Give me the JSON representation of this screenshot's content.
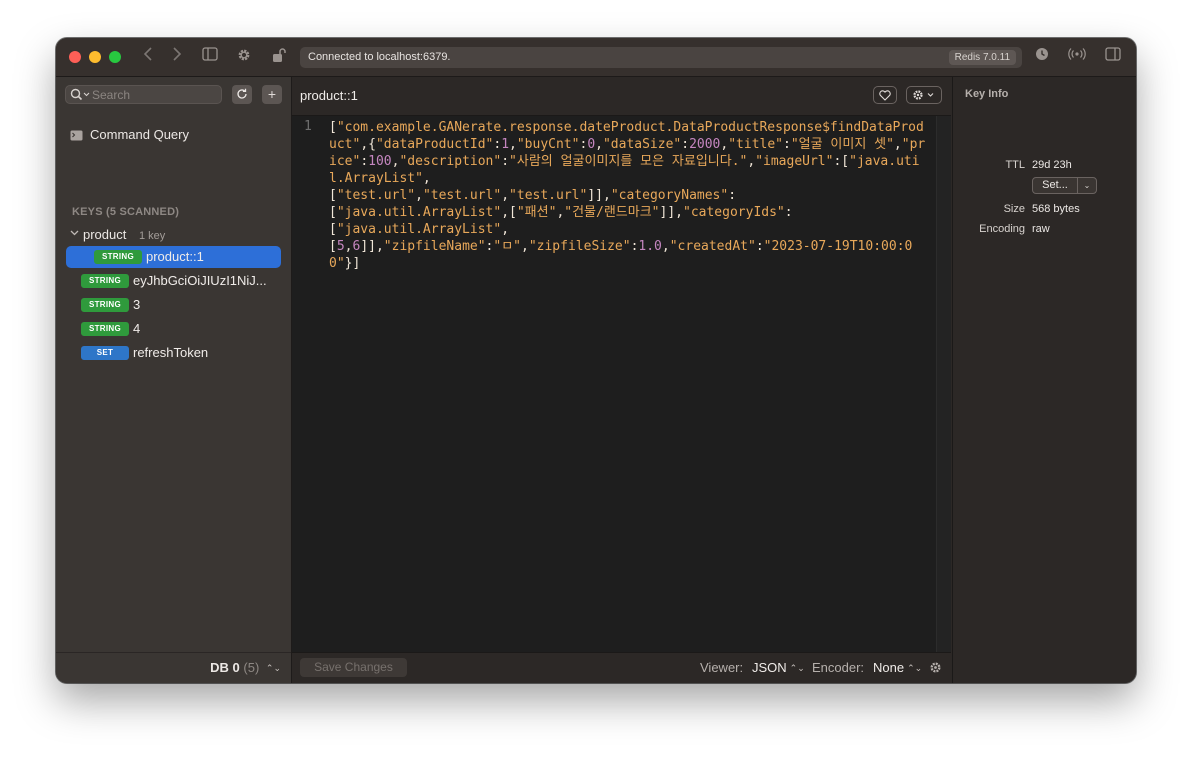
{
  "toolbar": {
    "status": "Connected to localhost:6379.",
    "server_version": "Redis 7.0.11"
  },
  "sidebar": {
    "search_placeholder": "Search",
    "command_query_label": "Command Query",
    "section_title": "KEYS (5 SCANNED)",
    "group": {
      "name": "product",
      "count": "1 key"
    },
    "keys": [
      {
        "type": "STRING",
        "name": "product::1",
        "selected": true
      },
      {
        "type": "STRING",
        "name": "eyJhbGciOiJIUzI1NiJ...",
        "selected": false
      },
      {
        "type": "STRING",
        "name": "3",
        "selected": false
      },
      {
        "type": "STRING",
        "name": "4",
        "selected": false
      },
      {
        "type": "SET",
        "name": "refreshToken",
        "selected": false
      }
    ],
    "db_label": "DB 0",
    "db_count": "(5)"
  },
  "main": {
    "key_title": "product::1",
    "line_number": "1",
    "save_label": "Save Changes",
    "viewer_label": "Viewer:",
    "viewer_value": "JSON",
    "encoder_label": "Encoder:",
    "encoder_value": "None"
  },
  "key_info": {
    "title": "Key Info",
    "ttl_label": "TTL",
    "ttl_value": "29d 23h",
    "set_button": "Set...",
    "size_label": "Size",
    "size_value": "568 bytes",
    "encoding_label": "Encoding",
    "encoding_value": "raw"
  },
  "value_tokens": [
    [
      "p",
      "["
    ],
    [
      "s",
      "\"com.example.GANerate.response.dateProduct.DataProductResponse$findDataProduct\""
    ],
    [
      "p",
      ",{"
    ],
    [
      "s",
      "\"dataProductId\""
    ],
    [
      "p",
      ":"
    ],
    [
      "n",
      "1"
    ],
    [
      "p",
      ","
    ],
    [
      "s",
      "\"buyCnt\""
    ],
    [
      "p",
      ":"
    ],
    [
      "n",
      "0"
    ],
    [
      "p",
      ","
    ],
    [
      "s",
      "\"dataSize\""
    ],
    [
      "p",
      ":"
    ],
    [
      "n",
      "2000"
    ],
    [
      "p",
      ","
    ],
    [
      "s",
      "\"title\""
    ],
    [
      "p",
      ":"
    ],
    [
      "s",
      "\"얼굴 이미지 셋\""
    ],
    [
      "p",
      ","
    ],
    [
      "s",
      "\"price\""
    ],
    [
      "p",
      ":"
    ],
    [
      "n",
      "100"
    ],
    [
      "p",
      ","
    ],
    [
      "s",
      "\"description\""
    ],
    [
      "p",
      ":"
    ],
    [
      "s",
      "\"사람의 얼굴이미지를 모은 자료입니다.\""
    ],
    [
      "p",
      ","
    ],
    [
      "s",
      "\"imageUrl\""
    ],
    [
      "p",
      ":["
    ],
    [
      "s",
      "\"java.util.ArrayList\""
    ],
    [
      "p",
      ",\n["
    ],
    [
      "s",
      "\"test.url\""
    ],
    [
      "p",
      ","
    ],
    [
      "s",
      "\"test.url\""
    ],
    [
      "p",
      ","
    ],
    [
      "s",
      "\"test.url\""
    ],
    [
      "p",
      "]],"
    ],
    [
      "s",
      "\"categoryNames\""
    ],
    [
      "p",
      ":\n["
    ],
    [
      "s",
      "\"java.util.ArrayList\""
    ],
    [
      "p",
      ",["
    ],
    [
      "s",
      "\"패션\""
    ],
    [
      "p",
      ","
    ],
    [
      "s",
      "\"건물/랜드마크\""
    ],
    [
      "p",
      "]],"
    ],
    [
      "s",
      "\"categoryIds\""
    ],
    [
      "p",
      ":\n["
    ],
    [
      "s",
      "\"java.util.ArrayList\""
    ],
    [
      "p",
      ",\n["
    ],
    [
      "n",
      "5"
    ],
    [
      "p",
      ","
    ],
    [
      "n",
      "6"
    ],
    [
      "p",
      "]],"
    ],
    [
      "s",
      "\"zipfileName\""
    ],
    [
      "p",
      ":"
    ],
    [
      "s",
      "\"ㅁ\""
    ],
    [
      "p",
      ","
    ],
    [
      "s",
      "\"zipfileSize\""
    ],
    [
      "p",
      ":"
    ],
    [
      "n",
      "1.0"
    ],
    [
      "p",
      ","
    ],
    [
      "s",
      "\"createdAt\""
    ],
    [
      "p",
      ":"
    ],
    [
      "s",
      "\"2023-07-19T10:00:00\""
    ],
    [
      "p",
      "}]"
    ]
  ],
  "colors": {
    "selected_row": "#2d6fd8",
    "string_badge": "#2f9a3c",
    "set_badge": "#2e76c8",
    "json_string": "#e8a85a",
    "json_number": "#c586c0"
  }
}
